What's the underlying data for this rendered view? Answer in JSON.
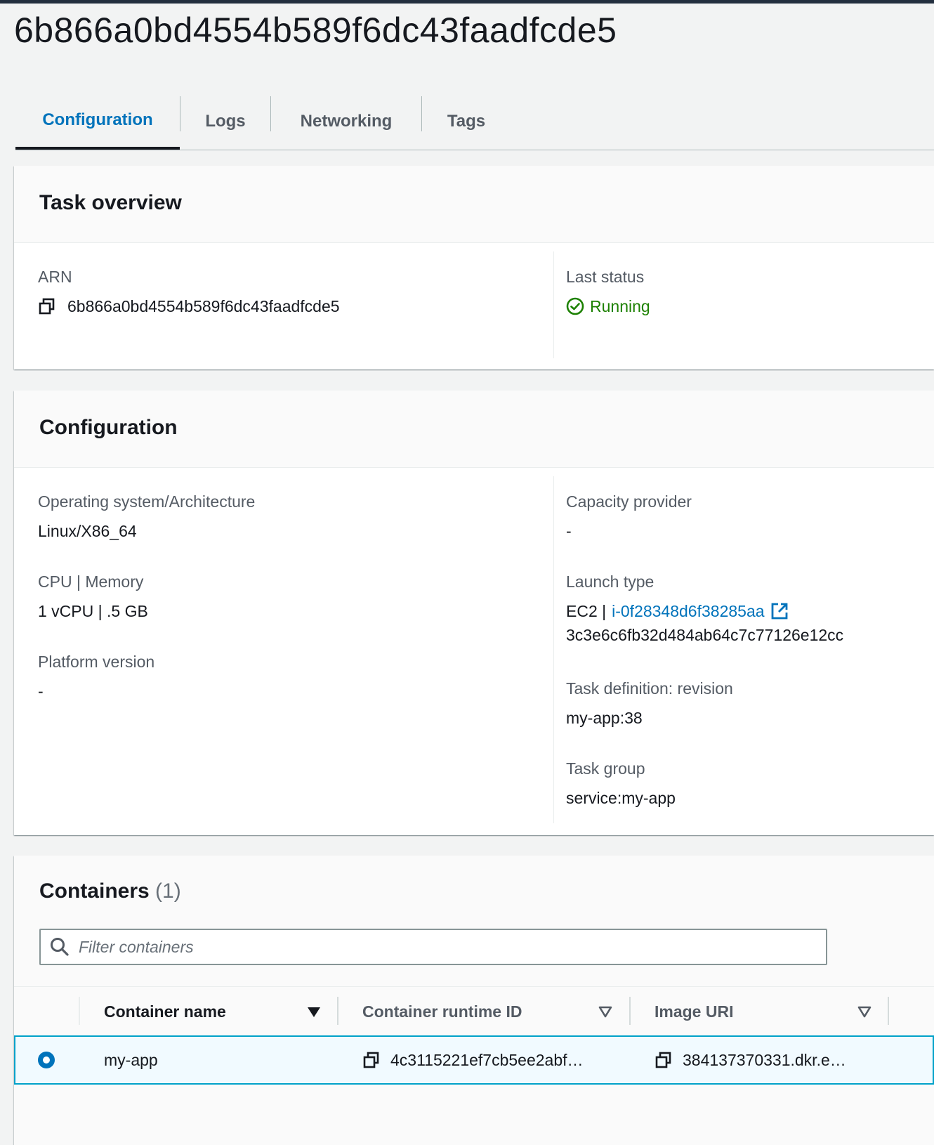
{
  "page": {
    "title": "6b866a0bd4554b589f6dc43faadfcde5"
  },
  "tabs": [
    {
      "label": "Configuration",
      "active": true
    },
    {
      "label": "Logs",
      "active": false
    },
    {
      "label": "Networking",
      "active": false
    },
    {
      "label": "Tags",
      "active": false
    }
  ],
  "task_overview": {
    "title": "Task overview",
    "arn_label": "ARN",
    "arn_value": "6b866a0bd4554b589f6dc43faadfcde5",
    "last_status_label": "Last status",
    "last_status_value": "Running"
  },
  "configuration": {
    "title": "Configuration",
    "os_label": "Operating system/Architecture",
    "os_value": "Linux/X86_64",
    "cpu_memory_label": "CPU | Memory",
    "cpu_memory_value": "1 vCPU | .5 GB",
    "platform_label": "Platform version",
    "platform_value": "-",
    "capacity_label": "Capacity provider",
    "capacity_value": "-",
    "launch_type_label": "Launch type",
    "launch_type_prefix": "EC2 |",
    "launch_instance_link": "i-0f28348d6f38285aa",
    "launch_instance_id2": "3c3e6c6fb32d484ab64c7c77126e12cc",
    "task_def_label": "Task definition: revision",
    "task_def_value": "my-app:38",
    "task_group_label": "Task group",
    "task_group_value": "service:my-app"
  },
  "containers": {
    "title": "Containers",
    "count": "(1)",
    "filter_placeholder": "Filter containers",
    "columns": [
      "Container name",
      "Container runtime ID",
      "Image URI"
    ],
    "rows": [
      {
        "name": "my-app",
        "runtime_id": "4c3115221ef7cb5ee2abf…",
        "image_uri": "384137370331.dkr.e…",
        "selected": true
      }
    ]
  },
  "colors": {
    "link": "#0073bb",
    "success": "#1d8102",
    "selected_row_border": "#00a1c9",
    "topbar": "#232f3e"
  }
}
